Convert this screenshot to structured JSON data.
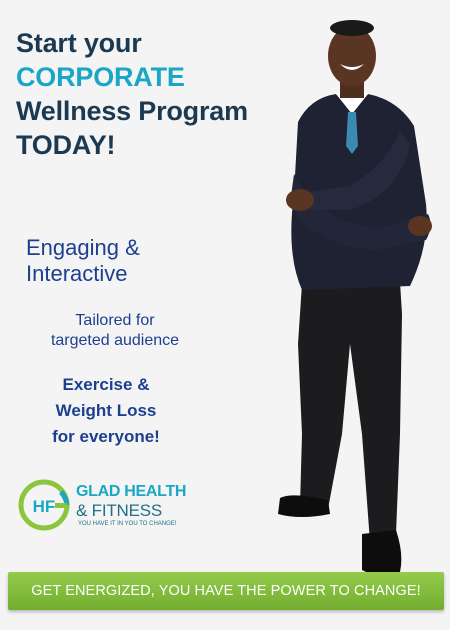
{
  "headline": {
    "line1": "Start your",
    "line2": "CORPORATE",
    "line3": "Wellness Program",
    "line4": "TODAY!"
  },
  "tagline": {
    "line1": "Engaging &",
    "line2": "Interactive"
  },
  "subtext": {
    "line1": "Tailored for",
    "line2": "targeted audience"
  },
  "exercise": {
    "line1": "Exercise &",
    "line2": "Weight Loss",
    "line3": "for everyone!"
  },
  "logo": {
    "monogram": "HF",
    "name_line1": "GLAD HEALTH",
    "name_line2": "& FITNESS",
    "slogan": "YOU HAVE IT IN YOU TO CHANGE!"
  },
  "banner": {
    "text": "GET ENERGIZED, YOU HAVE THE POWER TO CHANGE!"
  },
  "colors": {
    "heading_dark": "#1b3a52",
    "heading_accent": "#1aa6c4",
    "body_blue": "#1d3f8f",
    "banner_green": "#7fba3a",
    "logo_green": "#8cc63f"
  },
  "icons": {
    "logo_mark": "gf-monogram-circle-icon"
  }
}
